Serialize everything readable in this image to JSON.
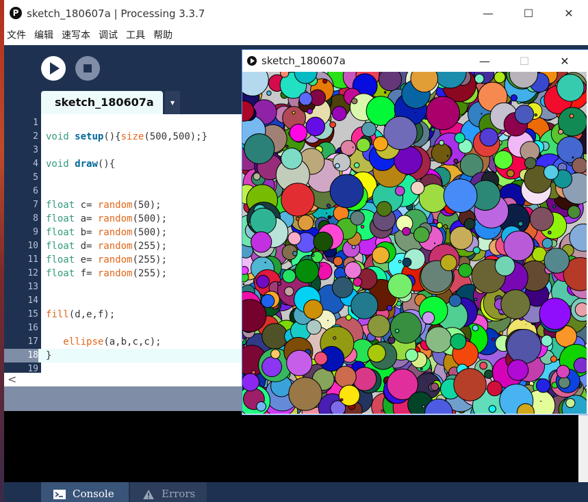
{
  "window": {
    "title": "sketch_180607a | Processing 3.3.7",
    "icon": "processing-logo-icon"
  },
  "menu": [
    "文件",
    "编辑",
    "速写本",
    "调试",
    "工具",
    "帮助"
  ],
  "toolbar": {
    "run": "play-icon",
    "stop": "stop-icon"
  },
  "tab": {
    "label": "sketch_180607a",
    "menu_icon": "▾"
  },
  "editor": {
    "current_line": 18,
    "lines": [
      {
        "n": "1",
        "t": ""
      },
      {
        "n": "2",
        "t": "void setup(){size(500,500);}"
      },
      {
        "n": "3",
        "t": ""
      },
      {
        "n": "4",
        "t": "void draw(){"
      },
      {
        "n": "5",
        "t": ""
      },
      {
        "n": "6",
        "t": ""
      },
      {
        "n": "7",
        "t": "float c= random(50);"
      },
      {
        "n": "8",
        "t": "float a= random(500);"
      },
      {
        "n": "9",
        "t": "float b= random(500);"
      },
      {
        "n": "10",
        "t": "float d= random(255);"
      },
      {
        "n": "11",
        "t": "float e= random(255);"
      },
      {
        "n": "12",
        "t": "float f= random(255);"
      },
      {
        "n": "13",
        "t": ""
      },
      {
        "n": "14",
        "t": ""
      },
      {
        "n": "15",
        "t": "fill(d,e,f);"
      },
      {
        "n": "16",
        "t": ""
      },
      {
        "n": "17",
        "t": "   ellipse(a,b,c,c);"
      },
      {
        "n": "18",
        "t": "}"
      },
      {
        "n": "19",
        "t": ""
      }
    ]
  },
  "scroll_left": "<",
  "console_tabs": [
    {
      "label": "Console",
      "icon": "console-icon"
    },
    {
      "label": "Errors",
      "icon": "warning-icon"
    }
  ],
  "sketch_window": {
    "title": "sketch_180607a",
    "minimize": "—",
    "maximize": "☐",
    "close": "✕",
    "canvas_background": "#c8c8c8"
  },
  "colors": {
    "toolbar_bg": "#1e3150",
    "editor_bg": "#ffffff",
    "keyword": "#33997e",
    "function": "#006699",
    "literal": "#e2661a"
  }
}
